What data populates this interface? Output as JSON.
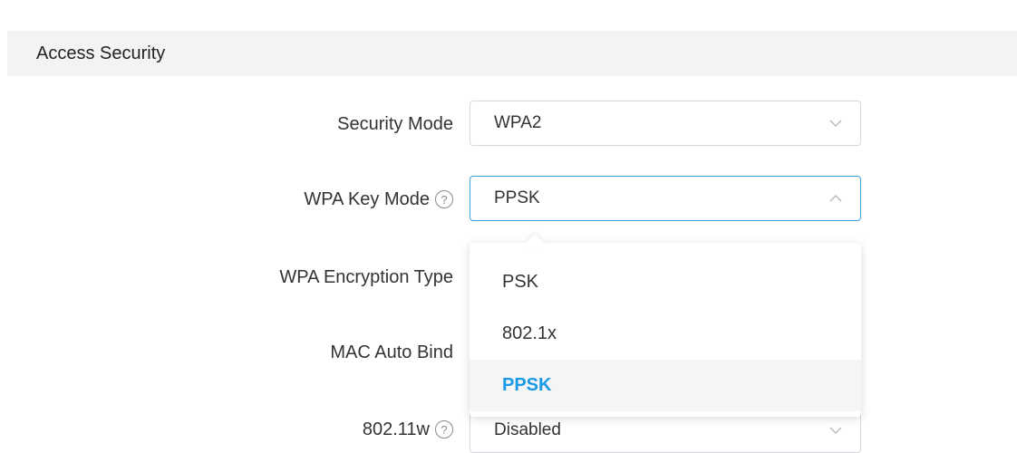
{
  "section": {
    "title": "Access Security"
  },
  "fields": {
    "security_mode": {
      "label": "Security Mode",
      "value": "WPA2"
    },
    "wpa_key_mode": {
      "label": "WPA Key Mode",
      "value": "PPSK",
      "help": "?"
    },
    "wpa_encryption_type": {
      "label": "WPA Encryption Type"
    },
    "mac_auto_bind": {
      "label": "MAC Auto Bind"
    },
    "dot11w": {
      "label": "802.11w",
      "value": "Disabled",
      "help": "?"
    }
  },
  "dropdown": {
    "options": [
      {
        "label": "PSK"
      },
      {
        "label": "802.1x"
      },
      {
        "label": "PPSK"
      }
    ],
    "selected": "PPSK"
  },
  "colors": {
    "accent": "#1a9ae6",
    "focus_border": "#3da0e0",
    "header_bg": "#f2f3f5"
  },
  "icons": {
    "chevron_down": "chevron-down-icon",
    "chevron_up": "chevron-up-icon",
    "help": "help-circle-icon"
  }
}
